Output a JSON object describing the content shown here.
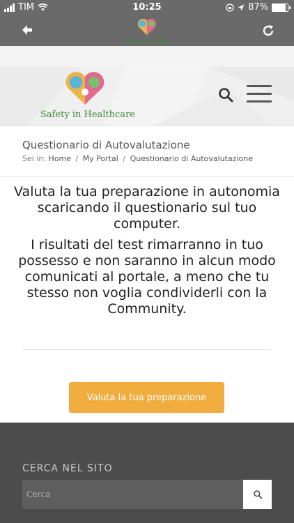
{
  "status_bar": {
    "carrier": "TIM",
    "time": "10:25",
    "battery": "87%",
    "battery_level": 0.87
  },
  "app_bar": {
    "logo_text": "Safety in Healthcare"
  },
  "header": {
    "logo_text": "Safety in Healthcare"
  },
  "page": {
    "title": "Questionario di Autovalutazione",
    "breadcrumb": {
      "label": "Sei in:",
      "items": [
        "Home",
        "My Portal",
        "Questionario di Autovalutazione"
      ],
      "separator": "/"
    }
  },
  "content": {
    "p1": "Valuta la tua preparazione in autonomia scaricando il questionario sul tuo computer.",
    "p2": "I risultati del test rimarranno in tuo possesso e non saranno in alcun modo comunicati al portale, a meno che tu stesso non voglia condividerli con la Community.",
    "cta_label": "Valuta la tua preparazione",
    "cta_color": "#f0ad3e"
  },
  "footer": {
    "heading": "CERCA NEL SITO",
    "search_placeholder": "Cerca"
  }
}
